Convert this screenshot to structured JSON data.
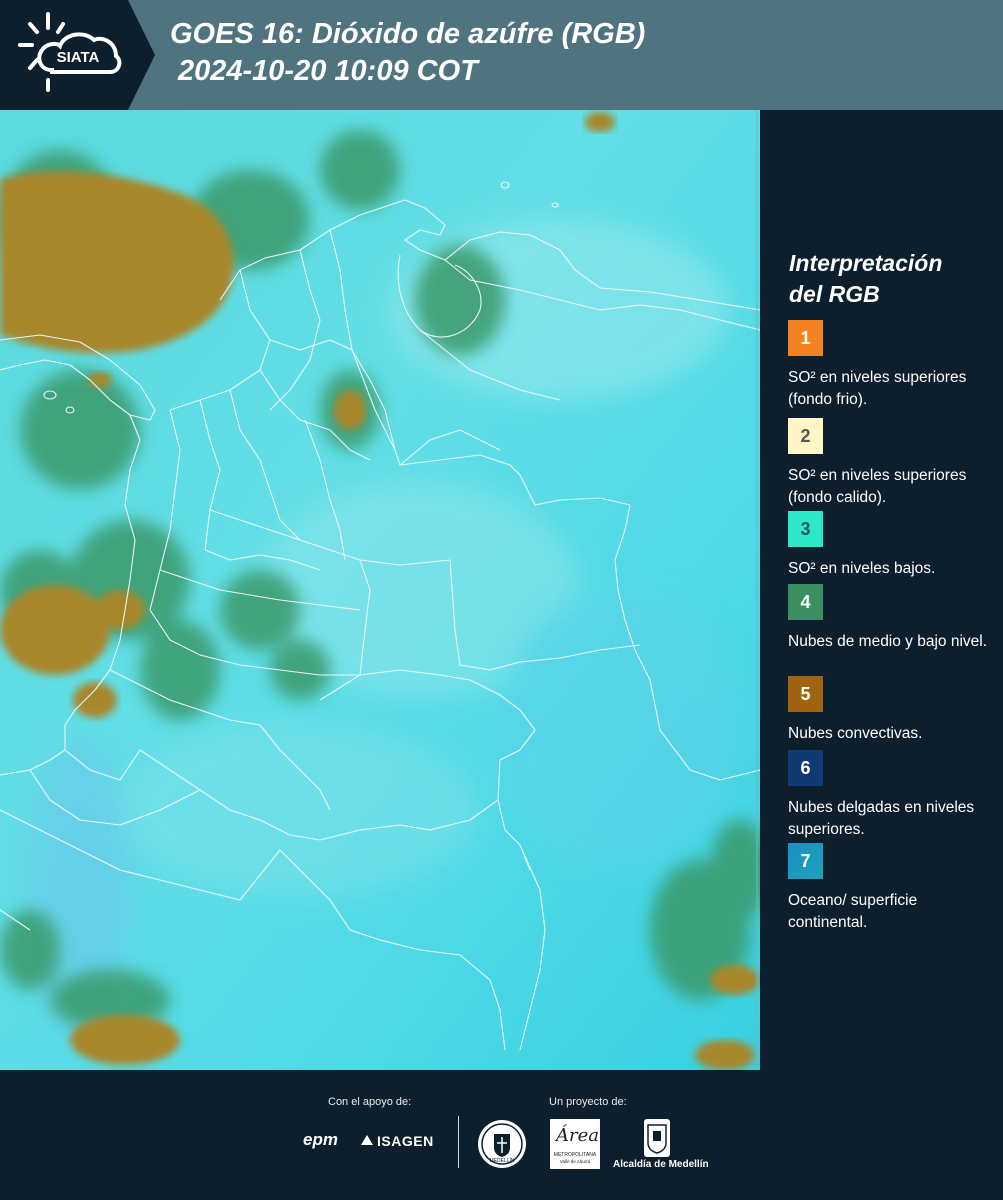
{
  "header": {
    "brand": "SIATA",
    "title_line1": "GOES 16: Dióxido de azúfre (RGB)",
    "title_line2": "2024-10-20 10:09 COT"
  },
  "legend": {
    "title_line1": "Interpretación",
    "title_line2": "del RGB",
    "items": [
      {
        "number": "1",
        "color": "#f58220",
        "text": "SO² en niveles superiores (fondo frio)."
      },
      {
        "number": "2",
        "color": "#fff6c8",
        "text": "SO² en niveles superiores (fondo calido)."
      },
      {
        "number": "3",
        "color": "#2de8c8",
        "text": "SO² en niveles bajos."
      },
      {
        "number": "4",
        "color": "#3c8f62",
        "text": "Nubes de medio y bajo nivel."
      },
      {
        "number": "5",
        "color": "#a06410",
        "text": "Nubes convectivas."
      },
      {
        "number": "6",
        "color": "#123a72",
        "text": "Nubes delgadas en niveles superiores."
      },
      {
        "number": "7",
        "color": "#1d8ec4",
        "text": "Oceano/ superficie continental."
      }
    ]
  },
  "footer": {
    "support_caption": "Con el apoyo de:",
    "project_caption": "Un proyecto de:",
    "sponsor1": "epm",
    "sponsor2": "ISAGEN",
    "area_logo_text": "Área",
    "area_logo_sub": "METROPOLITANA",
    "area_logo_sub2": "Valle de Aburrá",
    "alcaldia": "Alcaldía de Medellín",
    "seal_text": "MEDELLÍN"
  },
  "map_colors": {
    "background": "#3fd8e2",
    "convective": "#a8862a",
    "midlevel": "#3a9a6a",
    "borders": "#e8f6f8"
  }
}
